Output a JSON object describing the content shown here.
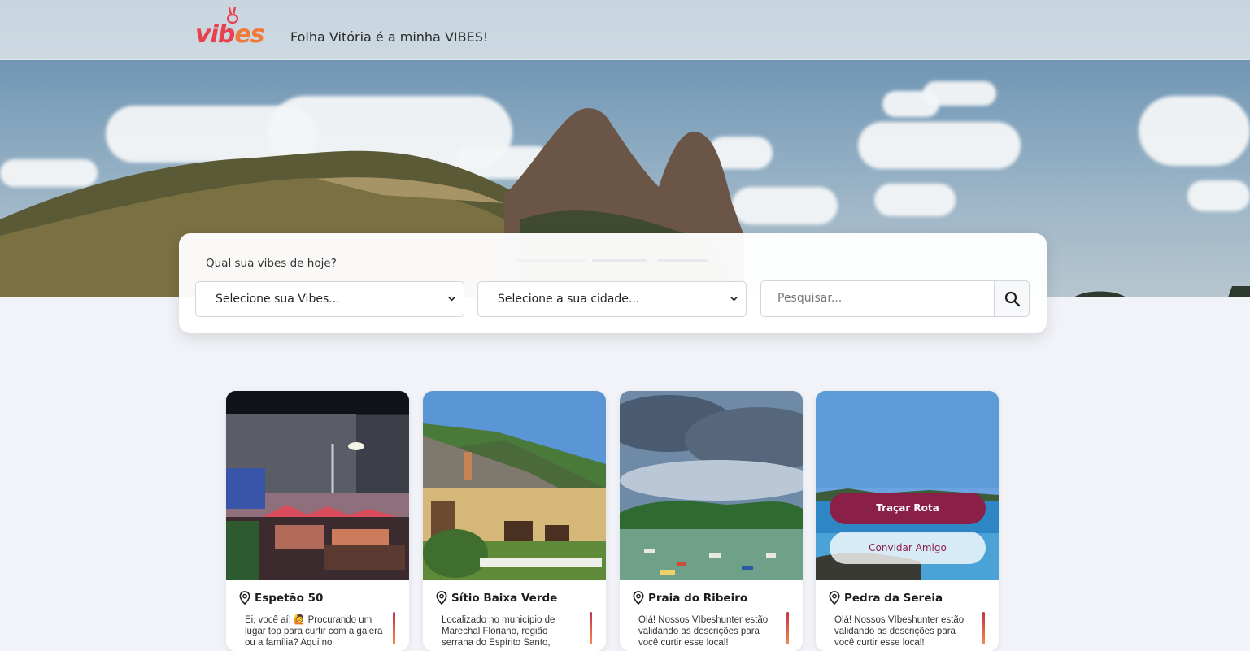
{
  "header": {
    "logo_text_main": "vib",
    "logo_text_end": "es",
    "tagline": "Folha Vitória é a minha VIBES!"
  },
  "search": {
    "label": "Qual sua vibes de hoje?",
    "vibes_select": "Selecione sua Vibes...",
    "city_select": "Selecione a sua cidade...",
    "search_placeholder": "Pesquisar...",
    "search_icon": "search-icon"
  },
  "cards": [
    {
      "title": "Espetão 50",
      "description": "Ei, você aí! 🙋 Procurando um lugar top para curtir com a galera ou a família? Aqui no"
    },
    {
      "title": "Sítio Baixa Verde",
      "description": "Localizado no município de Marechal Floriano, região serrana do Espírito Santo,"
    },
    {
      "title": "Praia do Ribeiro",
      "description": "Olá! Nossos VIbeshunter estão validando as descrições para você curtir esse local!"
    },
    {
      "title": "Pedra da Sereia",
      "description": "Olá! Nossos VIbeshunter estão validando as descrições para você curtir esse local!",
      "route_button": "Traçar Rota",
      "invite_button": "Convidar Amigo"
    }
  ],
  "colors": {
    "brand_red": "#e8404f",
    "brand_orange": "#f07a3a",
    "route_button": "#8a1f48"
  }
}
